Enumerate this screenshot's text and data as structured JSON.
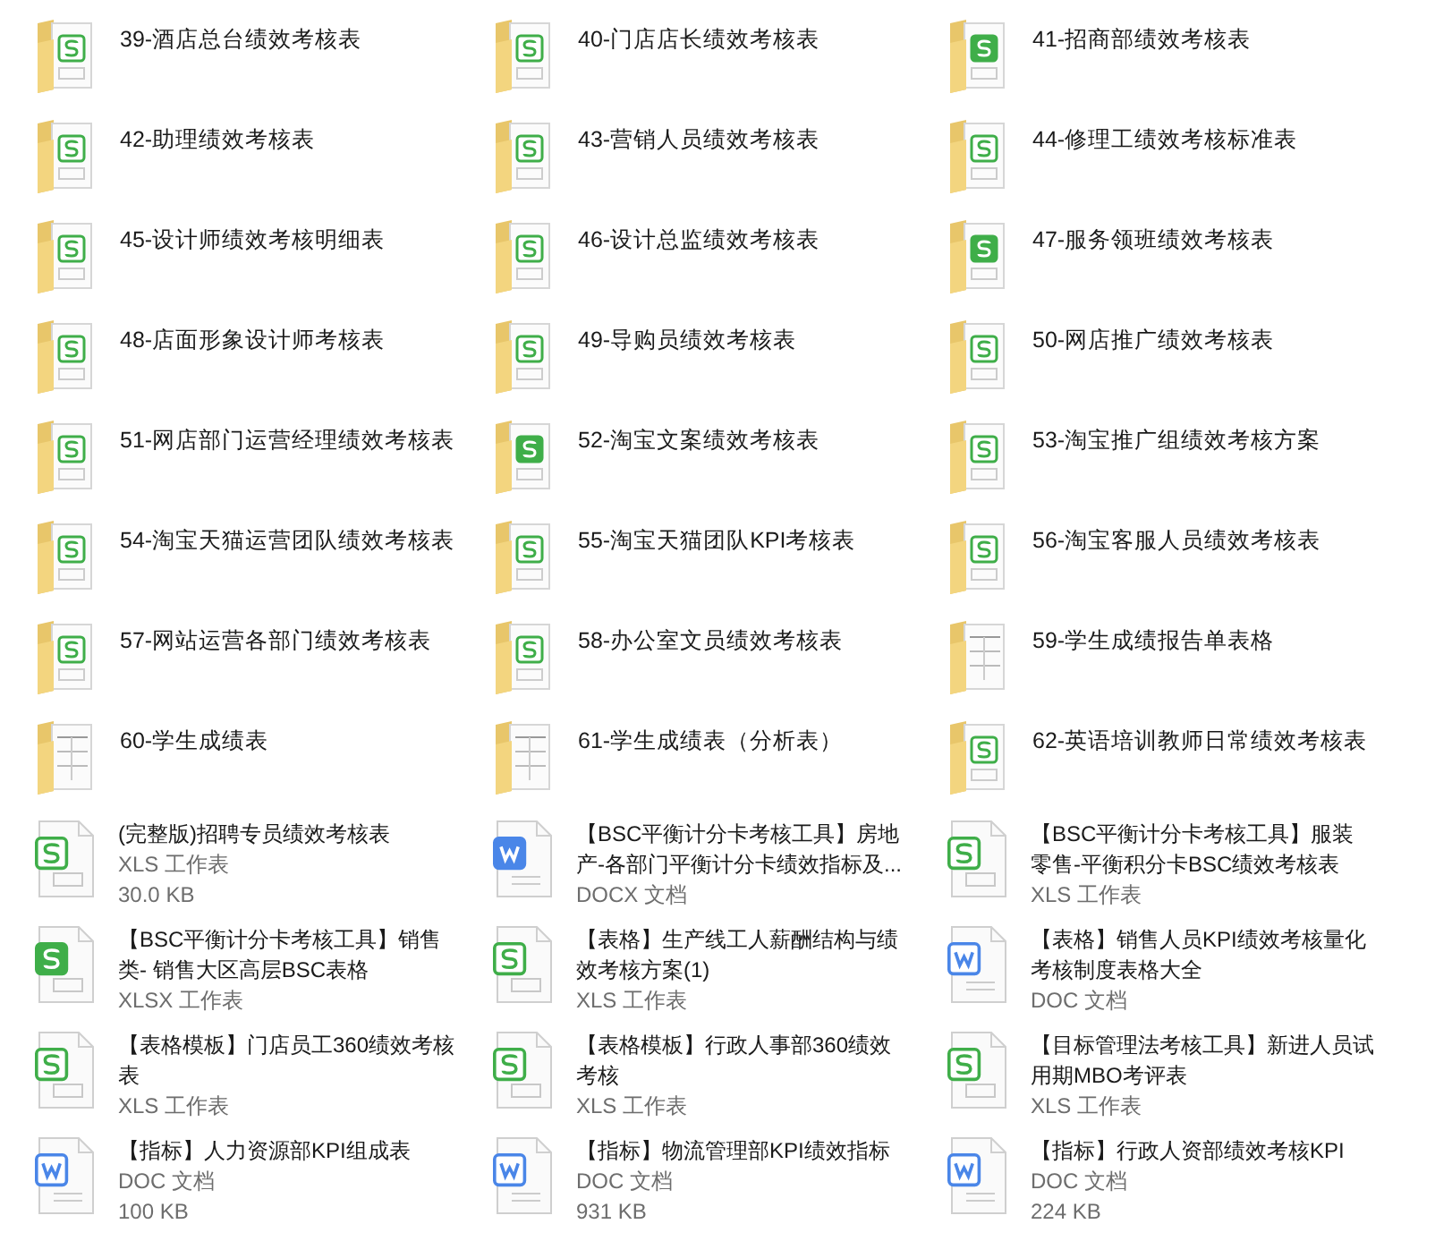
{
  "folders": [
    {
      "name": "39-酒店总台绩效考核表",
      "kind": "sheet"
    },
    {
      "name": "40-门店店长绩效考核表",
      "kind": "sheet"
    },
    {
      "name": "41-招商部绩效考核表",
      "kind": "sheet-solid"
    },
    {
      "name": "42-助理绩效考核表",
      "kind": "sheet"
    },
    {
      "name": "43-营销人员绩效考核表",
      "kind": "sheet"
    },
    {
      "name": "44-修理工绩效考核标准表",
      "kind": "sheet"
    },
    {
      "name": "45-设计师绩效考核明细表",
      "kind": "sheet"
    },
    {
      "name": "46-设计总监绩效考核表",
      "kind": "sheet"
    },
    {
      "name": "47-服务领班绩效考核表",
      "kind": "sheet-solid"
    },
    {
      "name": "48-店面形象设计师考核表",
      "kind": "sheet"
    },
    {
      "name": "49-导购员绩效考核表",
      "kind": "sheet"
    },
    {
      "name": "50-网店推广绩效考核表",
      "kind": "sheet"
    },
    {
      "name": "51-网店部门运营经理绩效考核表",
      "kind": "sheet"
    },
    {
      "name": "52-淘宝文案绩效考核表",
      "kind": "sheet-solid"
    },
    {
      "name": "53-淘宝推广组绩效考核方案",
      "kind": "sheet"
    },
    {
      "name": "54-淘宝天猫运营团队绩效考核表",
      "kind": "sheet"
    },
    {
      "name": "55-淘宝天猫团队KPI考核表",
      "kind": "sheet"
    },
    {
      "name": "56-淘宝客服人员绩效考核表",
      "kind": "sheet"
    },
    {
      "name": "57-网站运营各部门绩效考核表",
      "kind": "sheet"
    },
    {
      "name": "58-办公室文员绩效考核表",
      "kind": "sheet"
    },
    {
      "name": "59-学生成绩报告单表格",
      "kind": "preview"
    },
    {
      "name": "60-学生成绩表",
      "kind": "preview"
    },
    {
      "name": "61-学生成绩表（分析表）",
      "kind": "preview"
    },
    {
      "name": "62-英语培训教师日常绩效考核表",
      "kind": "sheet"
    }
  ],
  "files": [
    {
      "name": "(完整版)招聘专员绩效考核表",
      "type": "XLS 工作表",
      "size": "30.0 KB",
      "kind": "sheet"
    },
    {
      "name": "【BSC平衡计分卡考核工具】房地产-各部门平衡计分卡绩效指标及...",
      "type": "DOCX 文档",
      "kind": "doc-solid"
    },
    {
      "name": "【BSC平衡计分卡考核工具】服装零售-平衡积分卡BSC绩效考核表",
      "type": "XLS 工作表",
      "kind": "sheet"
    },
    {
      "name": "【BSC平衡计分卡考核工具】销售类- 销售大区高层BSC表格",
      "type": "XLSX 工作表",
      "kind": "sheet-solid"
    },
    {
      "name": "【表格】生产线工人薪酬结构与绩效考核方案(1)",
      "type": "XLS 工作表",
      "kind": "sheet"
    },
    {
      "name": "【表格】销售人员KPI绩效考核量化考核制度表格大全",
      "type": "DOC 文档",
      "kind": "doc"
    },
    {
      "name": "【表格模板】门店员工360绩效考核表",
      "type": "XLS 工作表",
      "kind": "sheet"
    },
    {
      "name": "【表格模板】行政人事部360绩效考核",
      "type": "XLS 工作表",
      "kind": "sheet"
    },
    {
      "name": "【目标管理法考核工具】新进人员试用期MBO考评表",
      "type": "XLS 工作表",
      "kind": "sheet"
    },
    {
      "name": "【指标】人力资源部KPI组成表",
      "type": "DOC 文档",
      "size": "100 KB",
      "kind": "doc"
    },
    {
      "name": "【指标】物流管理部KPI绩效指标",
      "type": "DOC 文档",
      "size": "931 KB",
      "kind": "doc"
    },
    {
      "name": "【指标】行政人资部绩效考核KPI",
      "type": "DOC 文档",
      "size": "224 KB",
      "kind": "doc"
    }
  ]
}
